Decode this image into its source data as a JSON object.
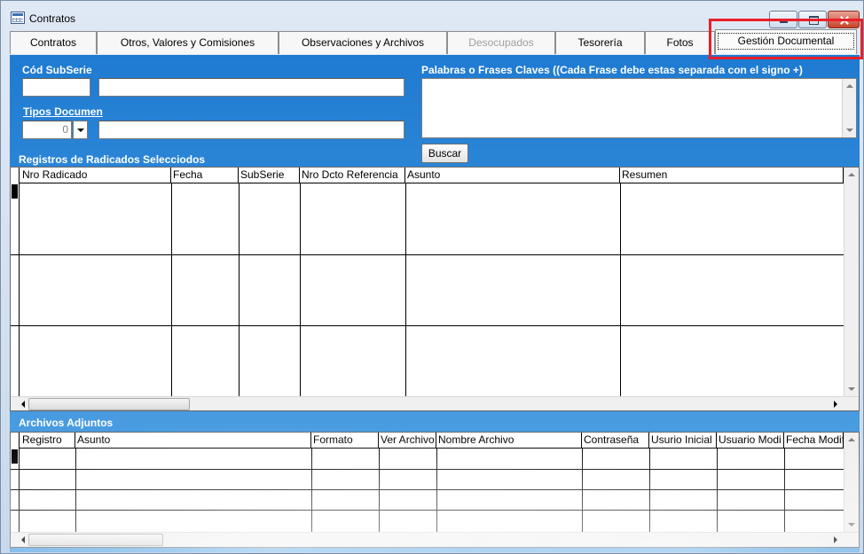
{
  "window": {
    "title": "Contratos"
  },
  "tabs": [
    {
      "label": "Contratos",
      "state": "normal"
    },
    {
      "label": "Otros, Valores y Comisiones",
      "state": "normal"
    },
    {
      "label": "Observaciones y Archivos",
      "state": "normal"
    },
    {
      "label": "Desocupados",
      "state": "disabled"
    },
    {
      "label": "Tesorería",
      "state": "normal"
    },
    {
      "label": "Fotos",
      "state": "normal"
    },
    {
      "label": "Gestión Documental",
      "state": "active"
    }
  ],
  "filters": {
    "cod_subserie_label": "Cód SubSerie",
    "cod_subserie_value": "",
    "cod_subserie_desc": "",
    "tipos_documen_label": "Tipos Documen",
    "tipos_documen_value": "0",
    "tipos_documen_desc": "",
    "keywords_label": "Palabras o Frases Claves ((Cada Frase debe estas separada con el signo +)",
    "keywords_value": "",
    "search_button": "Buscar"
  },
  "radicados": {
    "section_label": "Registros de Radicados Selecciodos",
    "columns": [
      "Nro Radicado",
      "Fecha",
      "SubSerie",
      "Nro Dcto Referencia",
      "Asunto",
      "Resumen"
    ],
    "rows": [
      [
        "",
        "",
        "",
        "",
        "",
        ""
      ],
      [
        "",
        "",
        "",
        "",
        "",
        ""
      ],
      [
        "",
        "",
        "",
        "",
        "",
        ""
      ]
    ]
  },
  "adjuntos": {
    "section_label": "Archivos Adjuntos",
    "columns": [
      "Registro",
      "Asunto",
      "Formato",
      "Ver Archivo",
      "Nombre Archivo",
      "Contraseña",
      "Usurio Inicial",
      "Usuario Modi",
      "Fecha Modif"
    ],
    "rows": [
      [
        "",
        "",
        "",
        "",
        "",
        "",
        "",
        "",
        ""
      ],
      [
        "",
        "",
        "",
        "",
        "",
        "",
        "",
        "",
        ""
      ],
      [
        "",
        "",
        "",
        "",
        "",
        "",
        "",
        "",
        ""
      ],
      [
        "",
        "",
        "",
        "",
        "",
        "",
        "",
        "",
        ""
      ]
    ]
  },
  "colors": {
    "panel": "#2f86d6",
    "highlight": "#e8202a"
  }
}
